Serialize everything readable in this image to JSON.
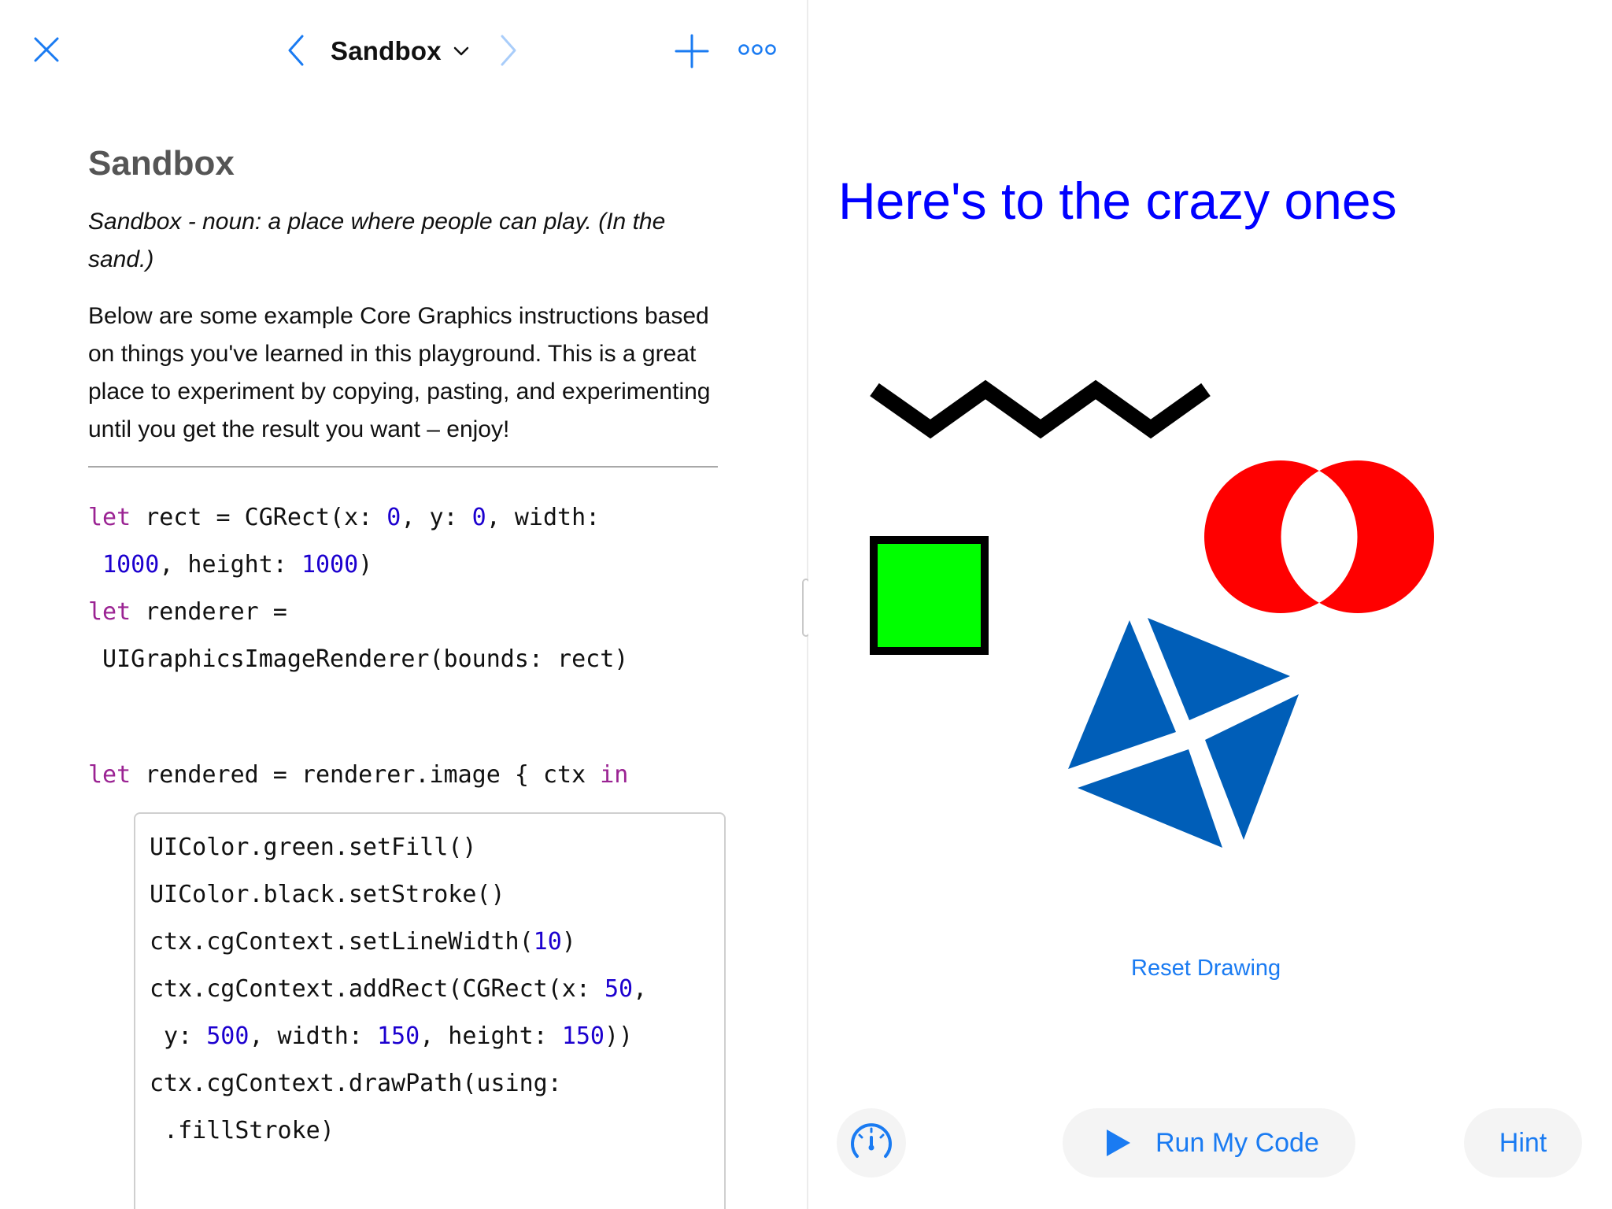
{
  "navbar": {
    "title": "Sandbox",
    "icons": [
      "close-icon",
      "chevron-left-icon",
      "chevron-down-icon",
      "chevron-right-icon",
      "plus-icon",
      "more-icon"
    ]
  },
  "page": {
    "heading": "Sandbox",
    "intro_italic": "Sandbox - noun: a place where people can play. (In the sand.)",
    "intro_body": "Below are some example Core Graphics instructions based on things you've learned in this playground. This is a great place to experiment by copying, pasting, and experimenting until you get the result you want – enjoy!"
  },
  "code": {
    "line1a": {
      "kw": "let",
      "t1": " rect = CGRect(x: ",
      "n1": "0",
      "t2": ", y: ",
      "n2": "0",
      "t3": ", width:"
    },
    "line1b": {
      "t1": " ",
      "n1": "1000",
      "t2": ", height: ",
      "n2": "1000",
      "t3": ")"
    },
    "line2a": {
      "kw": "let",
      "t1": " renderer ="
    },
    "line2b": {
      "t1": " UIGraphicsImageRenderer(bounds: rect)"
    },
    "line3": {
      "kw": "let",
      "t1": " rendered = renderer.image { ctx ",
      "kw2": "in"
    },
    "editable": {
      "l1": "UIColor.green.setFill()",
      "l2": "UIColor.black.setStroke()",
      "l3": {
        "t1": "ctx.cgContext.setLineWidth(",
        "n1": "10",
        "t2": ")"
      },
      "l4": {
        "t1": "ctx.cgContext.addRect(CGRect(x: ",
        "n1": "50",
        "t2": ","
      },
      "l5": {
        "t1": " y: ",
        "n1": "500",
        "t2": ", width: ",
        "n2": "150",
        "t3": ", height: ",
        "n3": "150",
        "t4": "))"
      },
      "l6": "ctx.cgContext.drawPath(using:",
      "l7": " .fillStroke)"
    }
  },
  "canvas": {
    "title": "Here's to the crazy ones",
    "title_color": "#0000ff",
    "shapes": {
      "zigzag_color": "#000000",
      "square_fill": "#00ff00",
      "square_stroke": "#000000",
      "circles_color": "#ff0000",
      "diamond_color": "#005eb8"
    },
    "reset_label": "Reset Drawing"
  },
  "bottom_bar": {
    "run_label": "Run My Code",
    "hint_label": "Hint",
    "speed_icon": "speedometer-icon",
    "run_icon": "play-icon"
  },
  "colors": {
    "accent": "#1a7bf2",
    "keyword": "#9b2393",
    "number": "#1c00cf"
  }
}
